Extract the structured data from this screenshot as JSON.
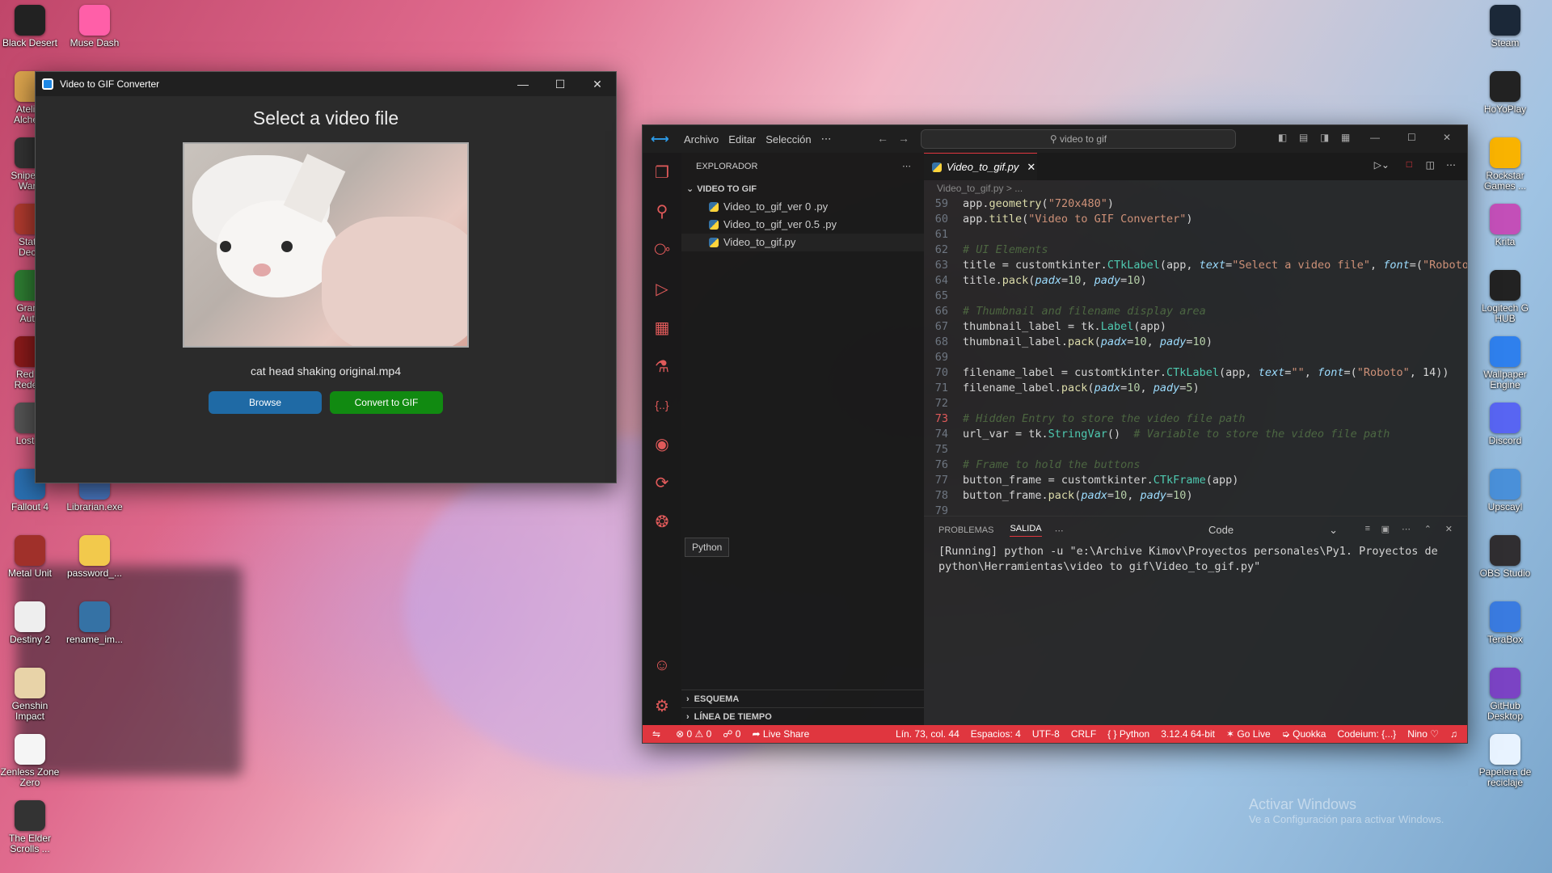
{
  "desktop": {
    "left_icons": [
      {
        "label": "Black Desert",
        "icon": "black-desert-icon",
        "color": "#222"
      },
      {
        "label": "Muse Dash",
        "icon": "muse-dash-icon",
        "color": "#ff5fa8"
      },
      {
        "label": "Atelier\nAlchem",
        "icon": "atelier-icon",
        "color": "#d9a24c"
      },
      {
        "label": "Sniper G\nWarri",
        "icon": "sniper-icon",
        "color": "#333"
      },
      {
        "label": "State\nDeca",
        "icon": "state-decay-icon",
        "color": "#b03a2e"
      },
      {
        "label": "Grand\nAuto",
        "icon": "gta-icon",
        "color": "#2e7d32"
      },
      {
        "label": "Red D\nRedem",
        "icon": "rdr-icon",
        "color": "#8b1a1a"
      },
      {
        "label": "Lost R",
        "icon": "lost-ruins-icon",
        "color": "#555"
      },
      {
        "label": "Fallout 4",
        "icon": "fallout-icon",
        "color": "#2a6fb0"
      },
      {
        "label": "Librarian.exe",
        "icon": "librarian-icon",
        "color": "#4a78c2"
      },
      {
        "label": "Metal Unit",
        "icon": "metal-unit-icon",
        "color": "#a0302a"
      },
      {
        "label": "password_...",
        "icon": "file-icon",
        "color": "#f2c94c"
      },
      {
        "label": "Destiny 2",
        "icon": "destiny-icon",
        "color": "#eeeeee"
      },
      {
        "label": "rename_im...",
        "icon": "python-file-icon",
        "color": "#3572a5"
      },
      {
        "label": "Genshin\nImpact",
        "icon": "genshin-icon",
        "color": "#e8d3a8"
      },
      {
        "label": "Zenless Zone\nZero",
        "icon": "zzz-icon",
        "color": "#f5f5f5"
      },
      {
        "label": "The Elder\nScrolls ...",
        "icon": "elder-scrolls-icon",
        "color": "#333"
      }
    ],
    "right_icons": [
      {
        "label": "Steam",
        "icon": "steam-icon",
        "color": "#1b2838"
      },
      {
        "label": "HoYoPlay",
        "icon": "hoyoplay-icon",
        "color": "#222"
      },
      {
        "label": "Rockstar\nGames ...",
        "icon": "rockstar-icon",
        "color": "#f9b300"
      },
      {
        "label": "Krita",
        "icon": "krita-icon",
        "color": "#c34fb8"
      },
      {
        "label": "Logitech G\nHUB",
        "icon": "logitech-icon",
        "color": "#222"
      },
      {
        "label": "Wallpaper\nEngine",
        "icon": "wallpaper-engine-icon",
        "color": "#2f80ed"
      },
      {
        "label": "Discord",
        "icon": "discord-icon",
        "color": "#5865f2"
      },
      {
        "label": "Upscayl",
        "icon": "upscayl-icon",
        "color": "#4a90d9"
      },
      {
        "label": "OBS Studio",
        "icon": "obs-icon",
        "color": "#302e31"
      },
      {
        "label": "TeraBox",
        "icon": "terabox-icon",
        "color": "#3a7be0"
      },
      {
        "label": "GitHub\nDesktop",
        "icon": "github-desktop-icon",
        "color": "#7b43c4"
      },
      {
        "label": "Papelera de\nreciclaje",
        "icon": "recycle-bin-icon",
        "color": "#e8f3ff"
      }
    ],
    "watermark_title": "Activar Windows",
    "watermark_sub": "Ve a Configuración para activar Windows."
  },
  "gif_app": {
    "window_title": "Video to GIF Converter",
    "heading": "Select a video file",
    "filename": "cat head shaking original.mp4",
    "browse_label": "Browse",
    "convert_label": "Convert to GIF",
    "browse_color": "#1f6aa5",
    "convert_color": "#118a11"
  },
  "vscode": {
    "menu": [
      "Archivo",
      "Editar",
      "Selección"
    ],
    "search": "video to gif",
    "explorer_title": "EXPLORADOR",
    "folder": "VIDEO TO GIF",
    "files": [
      "Video_to_gif_ver 0 .py",
      "Video_to_gif_ver 0.5 .py",
      "Video_to_gif.py"
    ],
    "outline": "ESQUEMA",
    "timeline": "LÍNEA DE TIEMPO",
    "tooltip": "Python",
    "tab": "Video_to_gif.py",
    "breadcrumb": "Video_to_gif.py > ...",
    "code": [
      {
        "n": "59",
        "t": "app.geometry(\"720x480\")"
      },
      {
        "n": "60",
        "t": "app.title(\"Video to GIF Converter\")"
      },
      {
        "n": "61",
        "t": ""
      },
      {
        "n": "62",
        "t": "# UI Elements"
      },
      {
        "n": "63",
        "t": "title = customtkinter.CTkLabel(app, text=\"Select a video file\", font=(\"Roboto\","
      },
      {
        "n": "64",
        "t": "title.pack(padx=10, pady=10)"
      },
      {
        "n": "65",
        "t": ""
      },
      {
        "n": "66",
        "t": "# Thumbnail and filename display area"
      },
      {
        "n": "67",
        "t": "thumbnail_label = tk.Label(app)"
      },
      {
        "n": "68",
        "t": "thumbnail_label.pack(padx=10, pady=10)"
      },
      {
        "n": "69",
        "t": ""
      },
      {
        "n": "70",
        "t": "filename_label = customtkinter.CTkLabel(app, text=\"\", font=(\"Roboto\", 14))"
      },
      {
        "n": "71",
        "t": "filename_label.pack(padx=10, pady=5)"
      },
      {
        "n": "72",
        "t": ""
      },
      {
        "n": "73",
        "t": "# Hidden Entry to store the video file path"
      },
      {
        "n": "74",
        "t": "url_var = tk.StringVar()  # Variable to store the video file path"
      },
      {
        "n": "75",
        "t": ""
      },
      {
        "n": "76",
        "t": "# Frame to hold the buttons"
      },
      {
        "n": "77",
        "t": "button_frame = customtkinter.CTkFrame(app)"
      },
      {
        "n": "78",
        "t": "button_frame.pack(padx=10, pady=10)"
      },
      {
        "n": "79",
        "t": ""
      }
    ],
    "panel_tabs": [
      "PROBLEMAS",
      "SALIDA"
    ],
    "panel_dropdown": "Code",
    "output": "[Running] python -u \"e:\\Archive Kimov\\Proyectos personales\\Py1. Proyectos de\npython\\Herramientas\\video to gif\\Video_to_gif.py\"",
    "status": {
      "errors": "0",
      "warnings": "0",
      "ports": "0",
      "live_share": "Live Share",
      "position": "Lín. 73, col. 44",
      "spaces": "Espacios: 4",
      "encoding": "UTF-8",
      "eol": "CRLF",
      "language": "Python",
      "interpreter": "3.12.4 64-bit",
      "go_live": "Go Live",
      "quokka": "Quokka",
      "codeium": "Codeium: {...}",
      "user": "Nino"
    }
  }
}
